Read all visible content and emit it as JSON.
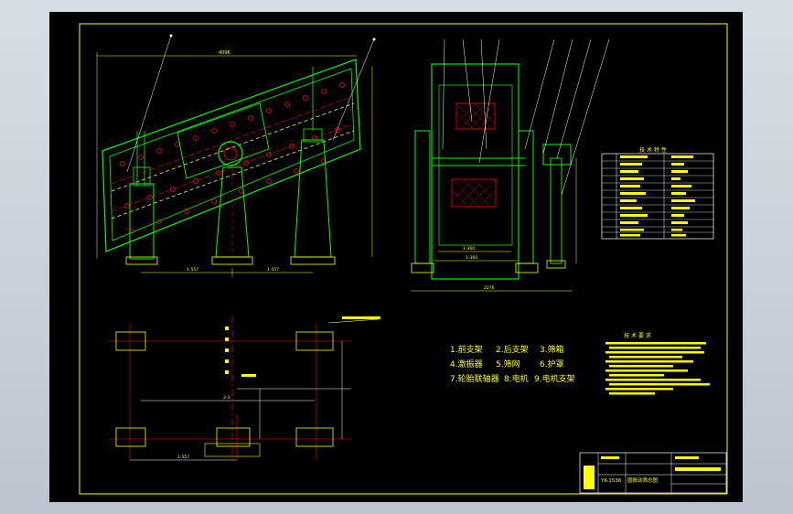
{
  "drawing": {
    "parts_legend": [
      "1.前支架",
      "2.后支架",
      "3.筛箱",
      "4.激振器",
      "5.筛网",
      "6.护罩",
      "7.轮胎联轴器",
      "8.电机",
      "9.电机支架"
    ],
    "table_title": "技 术 特 性",
    "requirements_title": "技 术 要 求",
    "title_block": {
      "part_number": "YK-1536",
      "drawing_name": "圆振动筛总图"
    },
    "dimensions": {
      "d_4096": "4096",
      "d_1557a": "1-557",
      "d_1557b": "1-557",
      "d_1360a": "1-360",
      "d_1360b": "1-360",
      "d_2276": "2276",
      "d_3": "3-3",
      "d_1557c": "1-557"
    },
    "colors": {
      "outline": "#ffff00",
      "body": "#00ff00",
      "hidden": "#ff0000",
      "text": "#ffff00",
      "leader": "#ffffff",
      "border": "#ffff00"
    }
  }
}
